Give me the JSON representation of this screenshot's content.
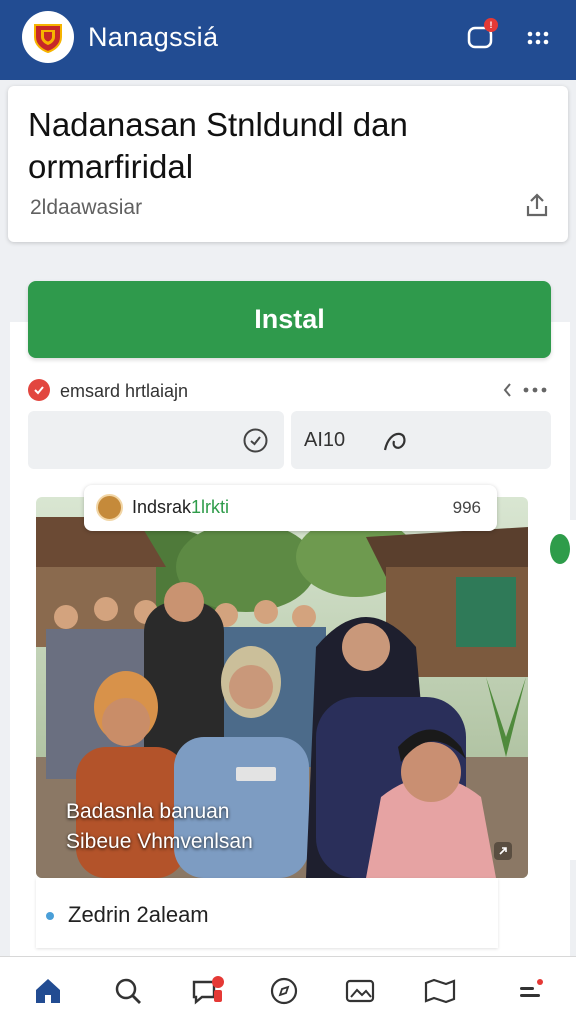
{
  "app": {
    "title": "Nanagssiá",
    "brand_color": "#224c92",
    "logo_icon": "shield-crest-icon"
  },
  "header": {
    "title": "Nadanasan Stnldundl dan ormarfiridal",
    "subtitle": "2ldaawasiar"
  },
  "install": {
    "label": "Instal",
    "color": "#2f9a4c"
  },
  "author": {
    "name": "emsard hrtlaiajn"
  },
  "stats": {
    "right_value": "AI10"
  },
  "post": {
    "tag_name_prefix": "Indsrak",
    "tag_name_highlight": "1lrkti",
    "tag_count": "996",
    "caption_line1": "Badasnla banuan",
    "caption_line2": "Sibeue Vhmvenlsan",
    "footer_text": "Zedrin 2aleam"
  },
  "nav": {
    "items": [
      "home-icon",
      "search-icon",
      "messages-icon",
      "compass-icon",
      "gallery-icon",
      "map-icon",
      "menu-icon"
    ]
  }
}
